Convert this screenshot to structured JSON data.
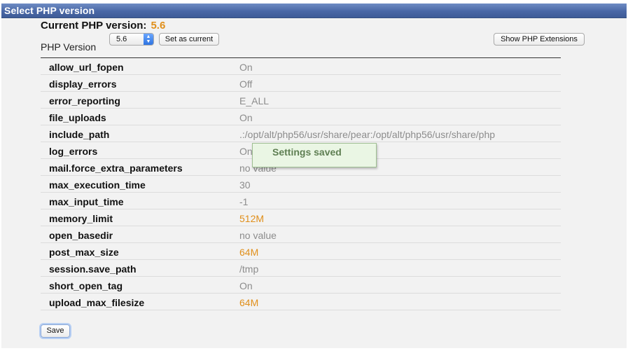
{
  "window": {
    "title": "Select PHP version"
  },
  "current": {
    "label": "Current PHP version:",
    "value": "5.6"
  },
  "selector": {
    "label": "PHP Version",
    "selected": "5.6",
    "set_button": "Set as current",
    "extensions_button": "Show PHP Extensions"
  },
  "options": [
    {
      "name": "allow_url_fopen",
      "value": "On",
      "changed": false
    },
    {
      "name": "display_errors",
      "value": "Off",
      "changed": false
    },
    {
      "name": "error_reporting",
      "value": "E_ALL",
      "changed": false
    },
    {
      "name": "file_uploads",
      "value": "On",
      "changed": false
    },
    {
      "name": "include_path",
      "value": ".:/opt/alt/php56/usr/share/pear:/opt/alt/php56/usr/share/php",
      "changed": false
    },
    {
      "name": "log_errors",
      "value": "On",
      "changed": false
    },
    {
      "name": "mail.force_extra_parameters",
      "value": "no value",
      "changed": false
    },
    {
      "name": "max_execution_time",
      "value": "30",
      "changed": false
    },
    {
      "name": "max_input_time",
      "value": "-1",
      "changed": false
    },
    {
      "name": "memory_limit",
      "value": "512M",
      "changed": true
    },
    {
      "name": "open_basedir",
      "value": "no value",
      "changed": false
    },
    {
      "name": "post_max_size",
      "value": "64M",
      "changed": true
    },
    {
      "name": "session.save_path",
      "value": "/tmp",
      "changed": false
    },
    {
      "name": "short_open_tag",
      "value": "On",
      "changed": false
    },
    {
      "name": "upload_max_filesize",
      "value": "64M",
      "changed": true
    }
  ],
  "toast": {
    "message": "Settings saved"
  },
  "footer": {
    "save_button": "Save"
  },
  "colors": {
    "title_bar": "#4a68a6",
    "changed_value": "#e08f1b",
    "default_value": "#8c8c8c",
    "toast_bg": "#eaf6e4",
    "toast_text": "#5f7f53"
  },
  "icons": {
    "select_arrows": "up-down-chevron-icon"
  }
}
